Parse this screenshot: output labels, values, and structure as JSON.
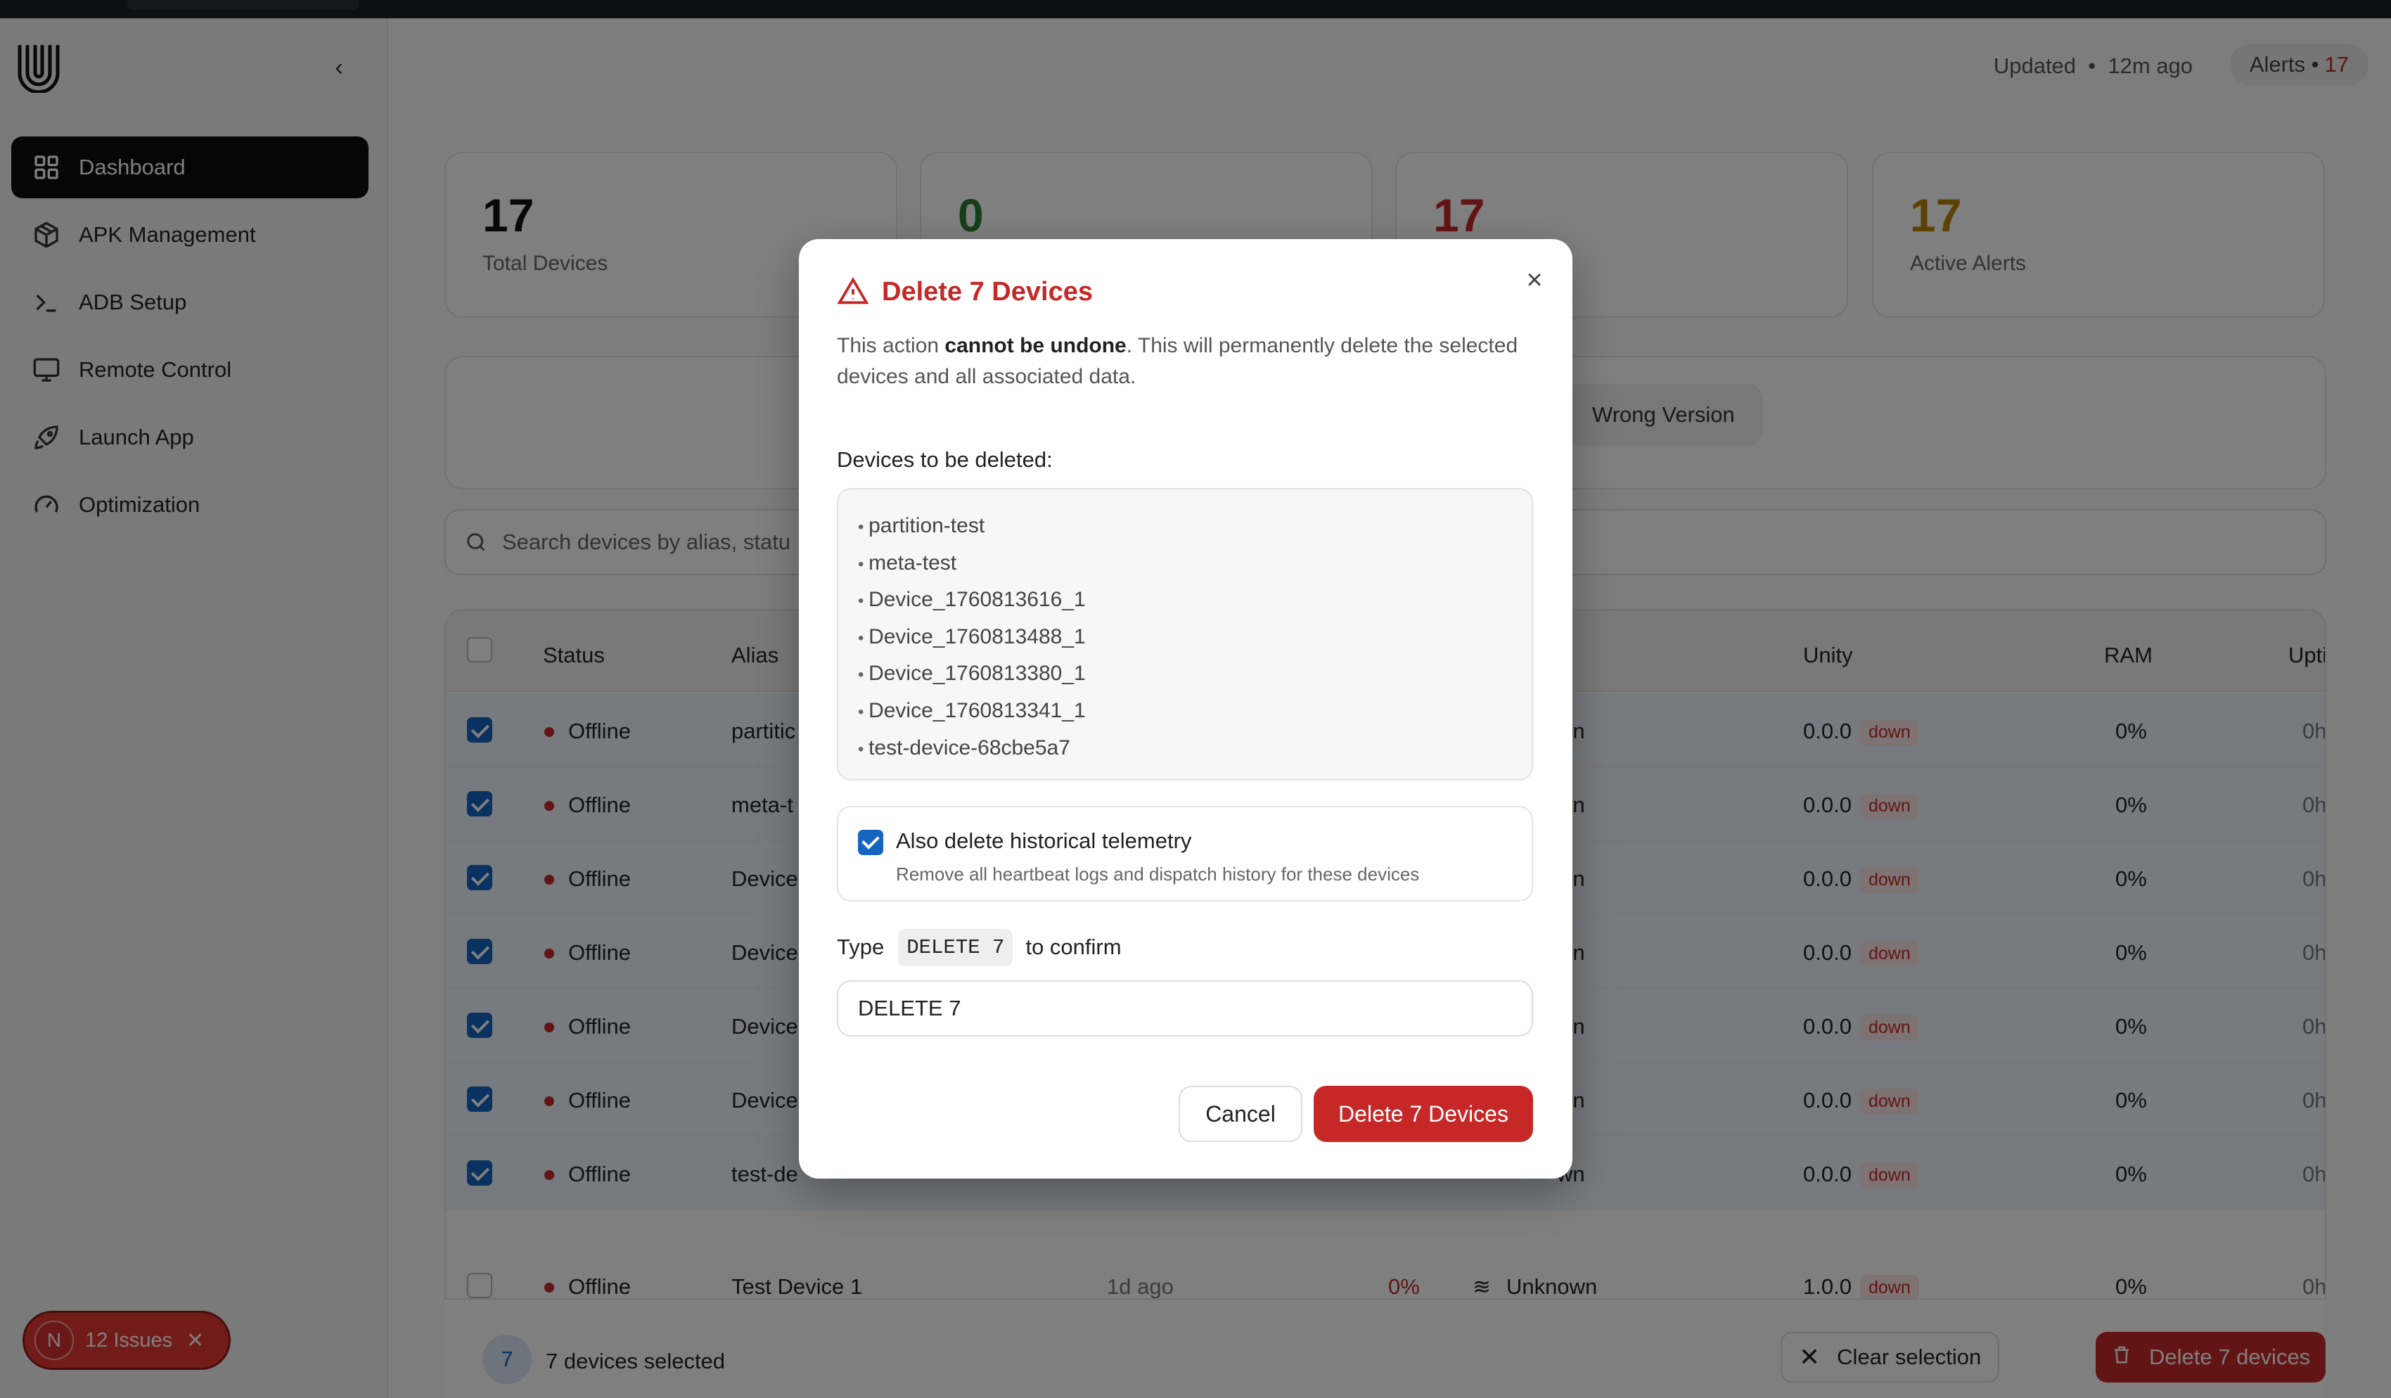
{
  "sidebar": {
    "items": [
      {
        "label": "Dashboard",
        "icon": "grid-icon"
      },
      {
        "label": "APK Management",
        "icon": "package-icon"
      },
      {
        "label": "ADB Setup",
        "icon": "terminal-icon"
      },
      {
        "label": "Remote Control",
        "icon": "monitor-icon"
      },
      {
        "label": "Launch App",
        "icon": "rocket-icon"
      },
      {
        "label": "Optimization",
        "icon": "gauge-icon"
      }
    ]
  },
  "header": {
    "updated_label": "Updated",
    "updated_time": "12m ago",
    "alerts_label": "Alerts",
    "alerts_count": "17"
  },
  "stats": [
    {
      "value": "17",
      "label": "Total Devices",
      "color": "#111111"
    },
    {
      "value": "0",
      "label": "",
      "color": "#2e7d32"
    },
    {
      "value": "17",
      "label": "",
      "color": "#c62828"
    },
    {
      "value": "17",
      "label": "Active Alerts",
      "color": "#b8860b"
    }
  ],
  "filter_chip": "Wrong Version",
  "search": {
    "placeholder": "Search devices by alias, statu"
  },
  "table": {
    "headers": {
      "status": "Status",
      "alias": "Alias",
      "unity": "Unity",
      "ram": "RAM",
      "uptime": "Uptime"
    },
    "rows": [
      {
        "status": "Offline",
        "alias": "partitic",
        "net": "wn",
        "unity": "0.0.0",
        "badge": "down",
        "ram": "0%",
        "uptime": "0h"
      },
      {
        "status": "Offline",
        "alias": "meta-t",
        "net": "wn",
        "unity": "0.0.0",
        "badge": "down",
        "ram": "0%",
        "uptime": "0h"
      },
      {
        "status": "Offline",
        "alias": "Device",
        "net": "wn",
        "unity": "0.0.0",
        "badge": "down",
        "ram": "0%",
        "uptime": "0h"
      },
      {
        "status": "Offline",
        "alias": "Device",
        "net": "wn",
        "unity": "0.0.0",
        "badge": "down",
        "ram": "0%",
        "uptime": "0h"
      },
      {
        "status": "Offline",
        "alias": "Device",
        "net": "wn",
        "unity": "0.0.0",
        "badge": "down",
        "ram": "0%",
        "uptime": "0h"
      },
      {
        "status": "Offline",
        "alias": "Device",
        "net": "wn",
        "unity": "0.0.0",
        "badge": "down",
        "ram": "0%",
        "uptime": "0h"
      },
      {
        "status": "Offline",
        "alias": "test-de",
        "net": "wn",
        "unity": "0.0.0",
        "badge": "down",
        "ram": "0%",
        "uptime": "0h"
      }
    ],
    "last_row": {
      "status": "Offline",
      "alias": "Test Device 1",
      "last_seen": "1d ago",
      "cpu": "0%",
      "net": "Unknown",
      "unity": "1.0.0",
      "badge": "down",
      "ram": "0%",
      "uptime": "0h"
    }
  },
  "selection": {
    "count": "7",
    "text": "7 devices selected",
    "clear": "Clear selection",
    "delete": "Delete 7 devices"
  },
  "issues": {
    "avatar": "N",
    "label": "12 Issues"
  },
  "modal": {
    "title": "Delete 7 Devices",
    "desc_pre": "This action ",
    "desc_bold": "cannot be undone",
    "desc_post": ". This will permanently delete the selected devices and all associated data.",
    "list_title": "Devices to be deleted:",
    "devices": [
      "partition-test",
      "meta-test",
      "Device_1760813616_1",
      "Device_1760813488_1",
      "Device_1760813380_1",
      "Device_1760813341_1",
      "test-device-68cbe5a7"
    ],
    "telemetry_label": "Also delete historical telemetry",
    "telemetry_desc": "Remove all heartbeat logs and dispatch history for these devices",
    "type_pre": "Type",
    "type_code": "DELETE 7",
    "type_post": "to confirm",
    "input_value": "DELETE 7",
    "cancel": "Cancel",
    "confirm": "Delete 7 Devices"
  },
  "colors": {
    "danger": "#c62828",
    "primary": "#1565c0",
    "nav_active": "#0d0d0d"
  }
}
